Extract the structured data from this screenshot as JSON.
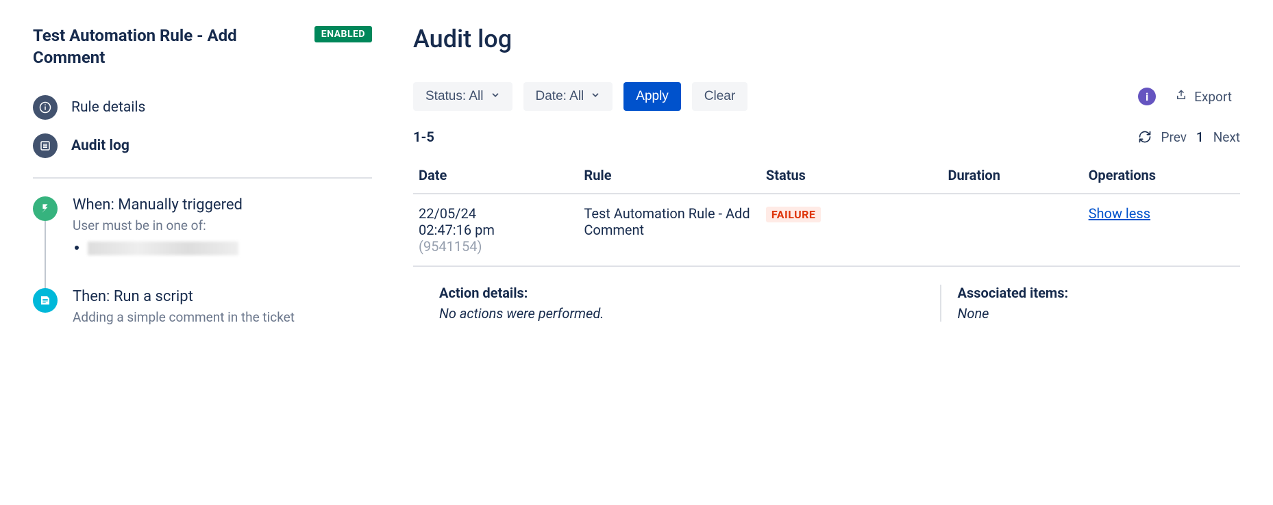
{
  "sidebar": {
    "rule_title": "Test Automation Rule - Add Comment",
    "status_badge": "ENABLED",
    "nav": {
      "details": "Rule details",
      "audit": "Audit log"
    },
    "steps": {
      "when": {
        "title": "When: Manually triggered",
        "sub": "User must be in one of:"
      },
      "then": {
        "title": "Then: Run a script",
        "sub": "Adding a simple comment in the ticket"
      }
    }
  },
  "main": {
    "heading": "Audit log",
    "filters": {
      "status_label": "Status: All",
      "date_label": "Date: All",
      "apply": "Apply",
      "clear": "Clear"
    },
    "export_label": "Export",
    "range": "1-5",
    "pager": {
      "prev": "Prev",
      "page": "1",
      "next": "Next"
    },
    "columns": {
      "date": "Date",
      "rule": "Rule",
      "status": "Status",
      "duration": "Duration",
      "operations": "Operations"
    },
    "row": {
      "date_line1": "22/05/24",
      "date_line2": "02:47:16 pm",
      "date_id": "(9541154)",
      "rule": "Test Automation Rule - Add Comment",
      "status": "FAILURE",
      "duration": "",
      "operation": "Show less"
    },
    "details": {
      "action_label": "Action details:",
      "action_value": "No actions were performed.",
      "assoc_label": "Associated items:",
      "assoc_value": "None"
    }
  }
}
